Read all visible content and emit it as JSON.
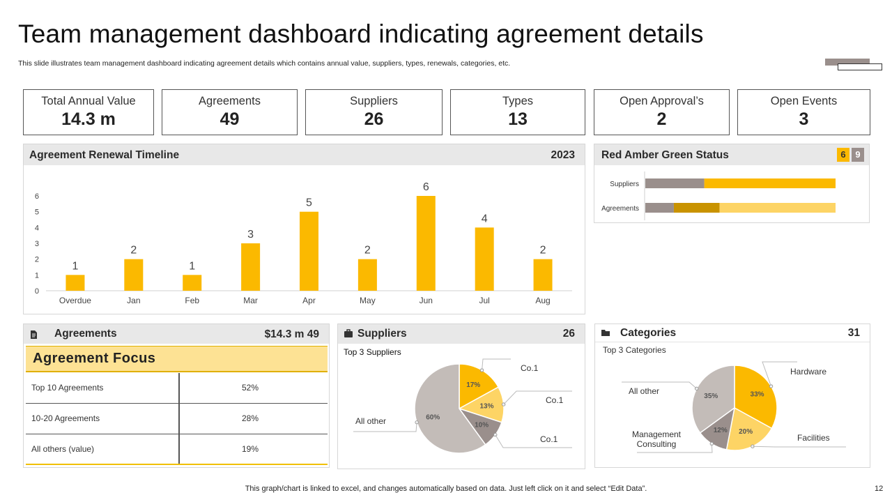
{
  "page": {
    "title": "Team management dashboard indicating agreement details",
    "subtitle": "This slide illustrates team management dashboard indicating agreement details which contains annual value, suppliers, types, renewals, categories, etc.",
    "footer": "This graph/chart is linked to excel,  and changes automatically based on data. Just left click on it and select “Edit Data”.",
    "page_number": "12"
  },
  "kpis": [
    {
      "label": "Total Annual Value",
      "value": "14.3 m"
    },
    {
      "label": "Agreements",
      "value": "49"
    },
    {
      "label": "Suppliers",
      "value": "26"
    },
    {
      "label": "Types",
      "value": "13"
    },
    {
      "label": "Open Approval’s",
      "value": "2"
    },
    {
      "label": "Open Events",
      "value": "3"
    }
  ],
  "timeline": {
    "title": "Agreement Renewal Timeline",
    "year": "2023"
  },
  "rag": {
    "title": "Red Amber Green Status",
    "badge_a": "6",
    "badge_b": "9",
    "rows": [
      {
        "label": "Suppliers",
        "segments": [
          {
            "value": 0.31,
            "color": "#9a8f8c"
          },
          {
            "value": 0.69,
            "color": "#fbb900"
          }
        ]
      },
      {
        "label": "Agreements",
        "segments": [
          {
            "value": 0.15,
            "color": "#9a8f8c"
          },
          {
            "value": 0.24,
            "color": "#c99300"
          },
          {
            "value": 0.61,
            "color": "#fdd465"
          }
        ]
      }
    ]
  },
  "agreements_panel": {
    "title": "Agreements",
    "value": "$14.3 m 49",
    "table_header": "Agreement Focus",
    "rows": [
      {
        "label": "Top 10 Agreements",
        "value": "52%"
      },
      {
        "label": "10-20 Agreements",
        "value": "28%"
      },
      {
        "label": "All others (value)",
        "value": "19%"
      }
    ]
  },
  "suppliers_panel": {
    "title": "Suppliers",
    "count": "26",
    "caption": "Top 3 Suppliers"
  },
  "categories_panel": {
    "title": "Categories",
    "count": "31",
    "caption": "Top 3 Categories"
  },
  "chart_data": [
    {
      "type": "bar",
      "categories": [
        "Overdue",
        "Jan",
        "Feb",
        "Mar",
        "Apr",
        "May",
        "Jun",
        "Jul",
        "Aug"
      ],
      "values": [
        1,
        2,
        1,
        3,
        5,
        2,
        6,
        4,
        2
      ],
      "ylim": [
        0,
        6
      ],
      "yticks": [
        0,
        1,
        2,
        3,
        4,
        5,
        6
      ],
      "color": "#fbb900"
    },
    {
      "type": "pie",
      "slices": [
        {
          "label": "Co.1",
          "pct_label": "17%",
          "value": 17,
          "color": "#fbb900"
        },
        {
          "label": "Co.1",
          "pct_label": "13%",
          "value": 13,
          "color": "#fdd465"
        },
        {
          "label": "Co.1",
          "pct_label": "10%",
          "value": 10,
          "color": "#9a8f8c"
        },
        {
          "label": "All other",
          "pct_label": "60%",
          "value": 60,
          "color": "#c3bcb8"
        }
      ]
    },
    {
      "type": "pie",
      "slices": [
        {
          "label": "Hardware",
          "pct_label": "33%",
          "value": 33,
          "color": "#fbb900"
        },
        {
          "label": "Facilities",
          "pct_label": "20%",
          "value": 20,
          "color": "#fdd465"
        },
        {
          "label": "Management Consulting",
          "pct_label": "12%",
          "value": 12,
          "color": "#9a8f8c"
        },
        {
          "label": "All other",
          "pct_label": "35%",
          "value": 35,
          "color": "#c3bcb8"
        }
      ]
    }
  ]
}
